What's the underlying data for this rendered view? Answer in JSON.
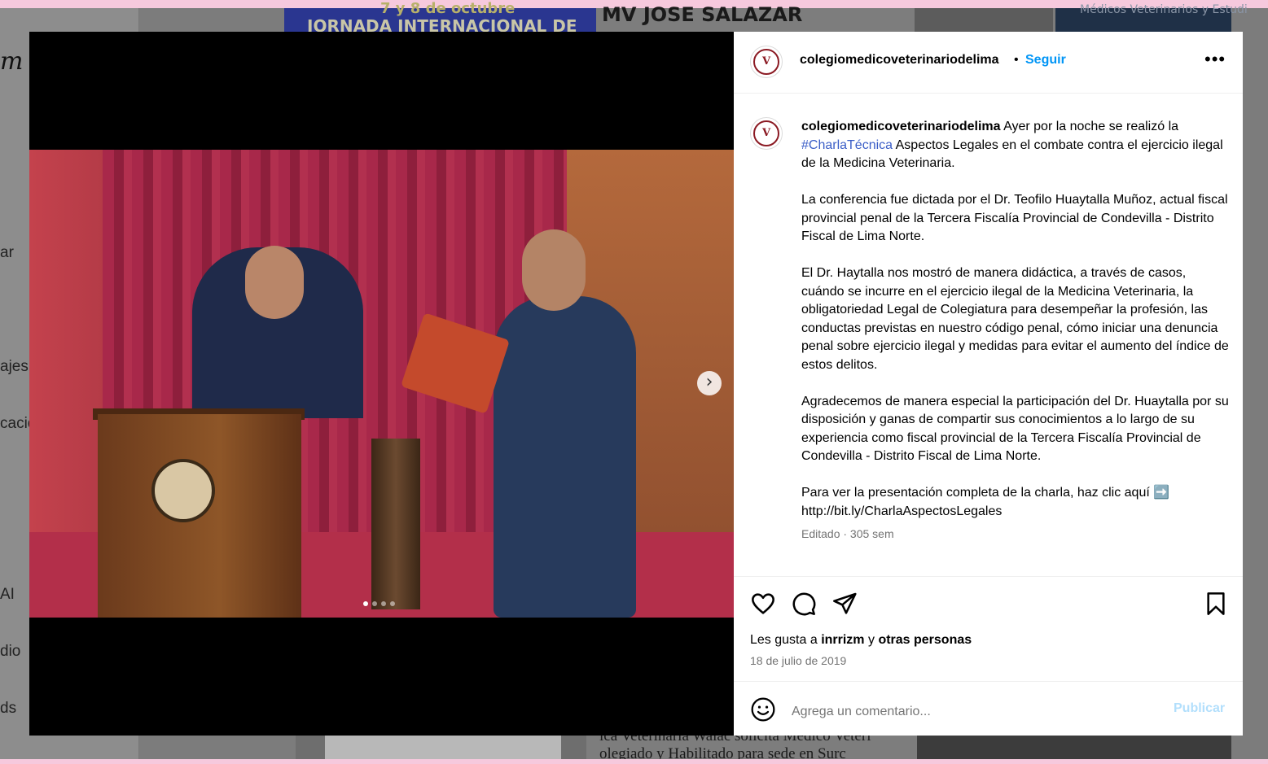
{
  "background": {
    "logo_fragment": "m",
    "sidebar_fragments": [
      "ar",
      "ajes",
      "cacio",
      "AI",
      "dio",
      "ds"
    ],
    "tiles": [
      {
        "text": "7 y 8 de octubre"
      },
      {
        "text": "JORNADA INTERNACIONAL DE"
      },
      {
        "text": "MV JOSE SALAZAR"
      },
      {
        "text": "Médicos Veterinarios y Estudi"
      },
      {
        "text": "ica Veterinaria Walac solicita Médico Veteri"
      },
      {
        "text": "olegiado y Habilitado para sede en Surc"
      }
    ]
  },
  "post": {
    "username": "colegiomedicoveterinariodelima",
    "separator": "•",
    "follow_label": "Seguir",
    "more_label": "•••",
    "caption": {
      "intro": "Ayer por la noche se realizó la",
      "hashtag": "#CharlaTécnica",
      "intro_rest": "Aspectos Legales en el combate contra el ejercicio ilegal de la Medicina Veterinaria.",
      "p2": "La conferencia fue dictada por el Dr. Teofilo Huaytalla Muñoz, actual fiscal provincial penal de la Tercera Fiscalía Provincial de Condevilla - Distrito Fiscal de Lima Norte.",
      "p3": "El Dr. Haytalla nos mostró de manera didáctica, a través de casos, cuándo se incurre en el ejercicio ilegal de la Medicina Veterinaria, la obligatoriedad Legal de Colegiatura para desempeñar la profesión, las conductas previstas en nuestro código penal, cómo iniciar una denuncia penal sobre ejercicio ilegal y medidas para evitar el aumento del índice de estos delitos.",
      "p4": "Agradecemos de manera especial la participación del Dr. Huaytalla por su disposición y ganas de compartir sus conocimientos a lo largo de su experiencia como fiscal provincial de la Tercera Fiscalía Provincial de Condevilla - Distrito Fiscal de Lima Norte.",
      "p5": "Para ver la presentación completa de la charla, haz clic aquí ➡️",
      "link": "http://bit.ly/CharlaAspectosLegales"
    },
    "meta": "Editado · 305 sem",
    "likes": {
      "prefix": "Les gusta a",
      "user": "inrrizm",
      "conj": "y",
      "others": "otras personas"
    },
    "date": "18 de julio de 2019",
    "comment_placeholder": "Agrega un comentario...",
    "publish_label": "Publicar",
    "carousel": {
      "count": 4,
      "active_index": 0
    },
    "icons": [
      "heart-icon",
      "comment-icon",
      "share-icon",
      "bookmark-icon",
      "emoji-icon",
      "chevron-right-icon"
    ]
  }
}
